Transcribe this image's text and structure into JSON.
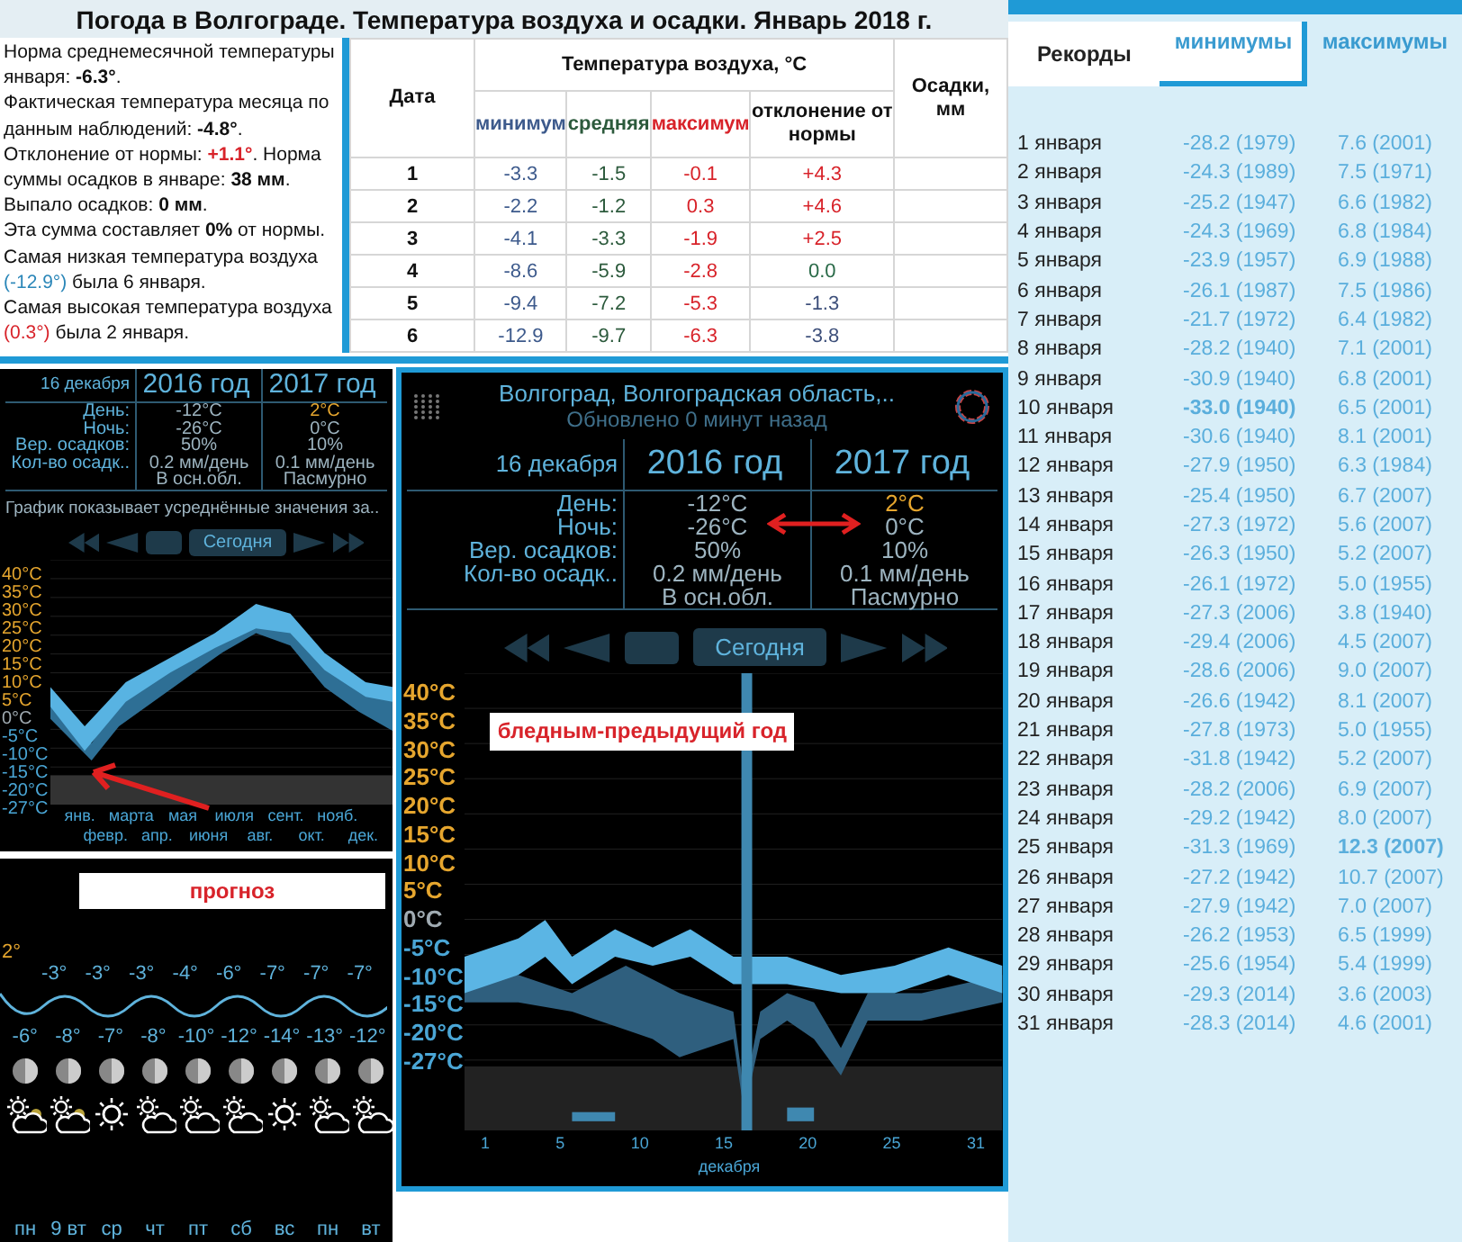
{
  "title": "Погода в Волгограде. Температура воздуха и осадки. Январь 2018 г.",
  "summary": [
    [
      {
        "text": "Норма среднемесячной температуры января: ",
        "kind": "plain"
      },
      {
        "text": "-6.3°",
        "kind": "bold"
      },
      {
        "text": ".",
        "kind": "plain"
      }
    ],
    [
      {
        "text": "Фактическая температура месяца по данным наблюдений: ",
        "kind": "plain"
      },
      {
        "text": "-4.8°",
        "kind": "bold"
      },
      {
        "text": ".",
        "kind": "plain"
      }
    ],
    [
      {
        "text": "Отклонение от нормы: ",
        "kind": "plain"
      },
      {
        "text": "+1.1°",
        "kind": "warm-bold"
      },
      {
        "text": ". Норма суммы осадков в январе: ",
        "kind": "plain"
      },
      {
        "text": "38 мм",
        "kind": "bold"
      },
      {
        "text": ".",
        "kind": "plain"
      }
    ],
    [
      {
        "text": "Выпало осадков: ",
        "kind": "plain"
      },
      {
        "text": "0 мм",
        "kind": "bold"
      },
      {
        "text": ".",
        "kind": "plain"
      }
    ],
    [
      {
        "text": "Эта сумма составляет ",
        "kind": "plain"
      },
      {
        "text": "0%",
        "kind": "bold"
      },
      {
        "text": " от нормы.",
        "kind": "plain"
      }
    ],
    [
      {
        "text": "Самая низкая температура воздуха ",
        "kind": "plain"
      },
      {
        "text": "(-12.9°)",
        "kind": "cold"
      },
      {
        "text": " была 6 января.",
        "kind": "plain"
      }
    ],
    [
      {
        "text": " Самая высокая температура воздуха ",
        "kind": "plain"
      },
      {
        "text": "(0.3°)",
        "kind": "warm"
      },
      {
        "text": " была 2 января.",
        "kind": "plain"
      }
    ]
  ],
  "table": {
    "date_header": "Дата",
    "group_header": "Температура воздуха, °C",
    "precip_header": "Осадки, мм",
    "subheaders": [
      {
        "label": "минимум",
        "color": "#3d5a8c"
      },
      {
        "label": "средняя",
        "color": "#2c5a3c"
      },
      {
        "label": "максимум",
        "color": "#d8232a"
      },
      {
        "label": "отклонение от нормы",
        "color": "#111111"
      }
    ],
    "rows": [
      {
        "date": "1",
        "min": "-3.3",
        "avg": "-1.5",
        "max": "-0.1",
        "deviation": "+4.3",
        "color": "#d8232a"
      },
      {
        "date": "2",
        "min": "-2.2",
        "avg": "-1.2",
        "max": "0.3",
        "deviation": "+4.6",
        "color": "#d8232a"
      },
      {
        "date": "3",
        "min": "-4.1",
        "avg": "-3.3",
        "max": "-1.9",
        "deviation": "+2.5",
        "color": "#d8232a"
      },
      {
        "date": "4",
        "min": "-8.6",
        "avg": "-5.9",
        "max": "-2.8",
        "deviation": "0.0",
        "color": "#2a6a48"
      },
      {
        "date": "5",
        "min": "-9.4",
        "avg": "-7.2",
        "max": "-5.3",
        "deviation": "-1.3",
        "color": "#3d4f7a"
      },
      {
        "date": "6",
        "min": "-12.9",
        "avg": "-9.7",
        "max": "-6.3",
        "deviation": "-3.8",
        "color": "#3d4f7a"
      }
    ]
  },
  "compact_widget": {
    "kind": "compact",
    "date": "16 декабря",
    "years": [
      "2016 год",
      "2017 год"
    ],
    "rows": [
      {
        "label": "День:",
        "values": [
          "-12°C",
          "2°C"
        ],
        "accent": [
          false,
          true
        ]
      },
      {
        "label": "Ночь:",
        "values": [
          "-26°C",
          "0°C"
        ],
        "accent": [
          false,
          false
        ]
      },
      {
        "label": "Вер. осадков:",
        "values": [
          "50%",
          "10%"
        ],
        "accent": [
          false,
          false
        ]
      },
      {
        "label": "Кол-во осадк..",
        "values": [
          "0.2 мм/день",
          "0.1 мм/день"
        ],
        "accent": [
          false,
          false
        ]
      },
      {
        "values": [
          "В осн.обл.",
          "Пасмурно"
        ],
        "accent": [
          false,
          false
        ]
      }
    ],
    "caption": "График показывает усреднённые значения за..",
    "today": "Сегодня",
    "ticks": [
      {
        "label": "40°C",
        "color": "#e6a62e"
      },
      {
        "label": "35°C",
        "color": "#e6a62e"
      },
      {
        "label": "30°C",
        "color": "#e6a62e"
      },
      {
        "label": "25°C",
        "color": "#e6a62e"
      },
      {
        "label": "20°C",
        "color": "#e6a62e"
      },
      {
        "label": "15°C",
        "color": "#e6a62e"
      },
      {
        "label": "10°C",
        "color": "#e6a62e"
      },
      {
        "label": "5°C",
        "color": "#e6a62e"
      },
      {
        "label": "0°C",
        "color": "#a0abb2"
      },
      {
        "label": "-5°C",
        "color": "#4aa6d6"
      },
      {
        "label": "-10°C",
        "color": "#4aa6d6"
      },
      {
        "label": "-15°C",
        "color": "#4aa6d6"
      },
      {
        "label": "-20°C",
        "color": "#4aa6d6"
      },
      {
        "label": "-27°C",
        "color": "#4aa6d6"
      }
    ],
    "x_labels": [
      "янв.",
      "февр.",
      "марта",
      "апр.",
      "мая",
      "июня",
      "июля",
      "авг.",
      "сент.",
      "окт.",
      "нояб.",
      "дек."
    ]
  },
  "forecast": {
    "note": "прогноз",
    "current": "2°",
    "highs": [
      "-3°",
      "-3°",
      "-3°",
      "-4°",
      "-6°",
      "-7°",
      "-7°",
      "-7°"
    ],
    "lows": [
      "-6°",
      "-8°",
      "-7°",
      "-8°",
      "-10°",
      "-12°",
      "-14°",
      "-13°",
      "-12°"
    ],
    "days": [
      {
        "label": "пн",
        "kind": "sun-cloud-rain"
      },
      {
        "label": "9 вт",
        "kind": "sun-cloud-rain"
      },
      {
        "label": "ср",
        "kind": "sun"
      },
      {
        "label": "чт",
        "kind": "sun-cloud"
      },
      {
        "label": "пт",
        "kind": "sun-cloud"
      },
      {
        "label": "сб",
        "kind": "sun-cloud"
      },
      {
        "label": "вс",
        "kind": "sun"
      },
      {
        "label": "пн",
        "kind": "sun-cloud"
      },
      {
        "label": "вт",
        "kind": "sun-cloud"
      }
    ]
  },
  "full_widget": {
    "kind": "full",
    "location": "Волгоград, Волгоградская область,..",
    "updated": "Обновлено 0 минут назад",
    "date": "16 декабря",
    "years": [
      "2016 год",
      "2017 год"
    ],
    "rows": [
      {
        "label": "День:",
        "values": [
          "-12°C",
          "2°C"
        ],
        "accent": [
          false,
          true
        ]
      },
      {
        "label": "Ночь:",
        "values": [
          "-26°C",
          "0°C"
        ],
        "accent": [
          false,
          false
        ]
      },
      {
        "label": "Вер. осадков:",
        "values": [
          "50%",
          "10%"
        ],
        "accent": [
          false,
          false
        ]
      },
      {
        "label": "Кол-во осадк..",
        "values": [
          "0.2 мм/день",
          "0.1 мм/день"
        ],
        "accent": [
          false,
          false
        ]
      },
      {
        "values": [
          "В осн.обл.",
          "Пасмурно"
        ],
        "accent": [
          false,
          false
        ]
      }
    ],
    "today": "Сегодня",
    "note": "бледным-предыдущий год",
    "ticks": [
      {
        "label": "40°C",
        "color": "#e6a62e"
      },
      {
        "label": "35°C",
        "color": "#e6a62e"
      },
      {
        "label": "30°C",
        "color": "#e6a62e"
      },
      {
        "label": "25°C",
        "color": "#e6a62e"
      },
      {
        "label": "20°C",
        "color": "#e6a62e"
      },
      {
        "label": "15°C",
        "color": "#e6a62e"
      },
      {
        "label": "10°C",
        "color": "#e6a62e"
      },
      {
        "label": "5°C",
        "color": "#e6a62e"
      },
      {
        "label": "0°C",
        "color": "#a0abb2"
      },
      {
        "label": "-5°C",
        "color": "#4aa6d6"
      },
      {
        "label": "-10°C",
        "color": "#4aa6d6"
      },
      {
        "label": "-15°C",
        "color": "#4aa6d6"
      },
      {
        "label": "-20°C",
        "color": "#4aa6d6"
      },
      {
        "label": "-27°C",
        "color": "#4aa6d6"
      }
    ],
    "x_labels": [
      "1",
      "5",
      "10",
      "15",
      "20",
      "25",
      "31"
    ],
    "x_title": "декабря"
  },
  "records": {
    "heading": "Рекорды",
    "tabs": [
      {
        "label": "минимумы",
        "selected": true
      },
      {
        "label": "максимумы",
        "selected": false
      }
    ],
    "rows": [
      {
        "day": "1 января",
        "min": "-28.2 (1979)",
        "max": "7.6 (2001)",
        "kind": "plain"
      },
      {
        "day": "2 января",
        "min": "-24.3 (1989)",
        "max": "7.5 (1971)",
        "kind": "plain"
      },
      {
        "day": "3 января",
        "min": "-25.2 (1947)",
        "max": "6.6 (1982)",
        "kind": "plain"
      },
      {
        "day": "4 января",
        "min": "-24.3 (1969)",
        "max": "6.8 (1984)",
        "kind": "plain"
      },
      {
        "day": "5 января",
        "min": "-23.9 (1957)",
        "max": "6.9 (1988)",
        "kind": "plain"
      },
      {
        "day": "6 января",
        "min": "-26.1 (1987)",
        "max": "7.5 (1986)",
        "kind": "plain"
      },
      {
        "day": "7 января",
        "min": "-21.7 (1972)",
        "max": "6.4 (1982)",
        "kind": "plain"
      },
      {
        "day": "8 января",
        "min": "-28.2 (1940)",
        "max": "7.1 (2001)",
        "kind": "plain"
      },
      {
        "day": "9 января",
        "min": "-30.9 (1940)",
        "max": "6.8 (2001)",
        "kind": "plain"
      },
      {
        "day": "10 января",
        "min": "-33.0 (1940)",
        "max": "6.5 (2001)",
        "kind": "min-record"
      },
      {
        "day": "11 января",
        "min": "-30.6 (1940)",
        "max": "8.1 (2001)",
        "kind": "plain"
      },
      {
        "day": "12 января",
        "min": "-27.9 (1950)",
        "max": "6.3 (1984)",
        "kind": "plain"
      },
      {
        "day": "13 января",
        "min": "-25.4 (1950)",
        "max": "6.7 (2007)",
        "kind": "plain"
      },
      {
        "day": "14 января",
        "min": "-27.3 (1972)",
        "max": "5.6 (2007)",
        "kind": "plain"
      },
      {
        "day": "15 января",
        "min": "-26.3 (1950)",
        "max": "5.2 (2007)",
        "kind": "plain"
      },
      {
        "day": "16 января",
        "min": "-26.1 (1972)",
        "max": "5.0 (1955)",
        "kind": "plain"
      },
      {
        "day": "17 января",
        "min": "-27.3 (2006)",
        "max": "3.8 (1940)",
        "kind": "plain"
      },
      {
        "day": "18 января",
        "min": "-29.4 (2006)",
        "max": "4.5 (2007)",
        "kind": "plain"
      },
      {
        "day": "19 января",
        "min": "-28.6 (2006)",
        "max": "9.0 (2007)",
        "kind": "plain"
      },
      {
        "day": "20 января",
        "min": "-26.6 (1942)",
        "max": "8.1 (2007)",
        "kind": "plain"
      },
      {
        "day": "21 января",
        "min": "-27.8 (1973)",
        "max": "5.0 (1955)",
        "kind": "plain"
      },
      {
        "day": "22 января",
        "min": "-31.8 (1942)",
        "max": "5.2 (2007)",
        "kind": "plain"
      },
      {
        "day": "23 января",
        "min": "-28.2 (2006)",
        "max": "6.9 (2007)",
        "kind": "plain"
      },
      {
        "day": "24 января",
        "min": "-29.2 (1942)",
        "max": "8.0 (2007)",
        "kind": "plain"
      },
      {
        "day": "25 января",
        "min": "-31.3 (1969)",
        "max": "12.3 (2007)",
        "kind": "max-record"
      },
      {
        "day": "26 января",
        "min": "-27.2 (1942)",
        "max": "10.7 (2007)",
        "kind": "plain"
      },
      {
        "day": "27 января",
        "min": "-27.9 (1942)",
        "max": "7.0 (2007)",
        "kind": "plain"
      },
      {
        "day": "28 января",
        "min": "-26.2 (1953)",
        "max": "6.5 (1999)",
        "kind": "plain"
      },
      {
        "day": "29 января",
        "min": "-25.6 (1954)",
        "max": "5.4 (1999)",
        "kind": "plain"
      },
      {
        "day": "30 января",
        "min": "-29.3 (2014)",
        "max": "3.6 (2003)",
        "kind": "plain"
      },
      {
        "day": "31 января",
        "min": "-28.3 (2014)",
        "max": "4.6 (2001)",
        "kind": "plain"
      }
    ]
  }
}
